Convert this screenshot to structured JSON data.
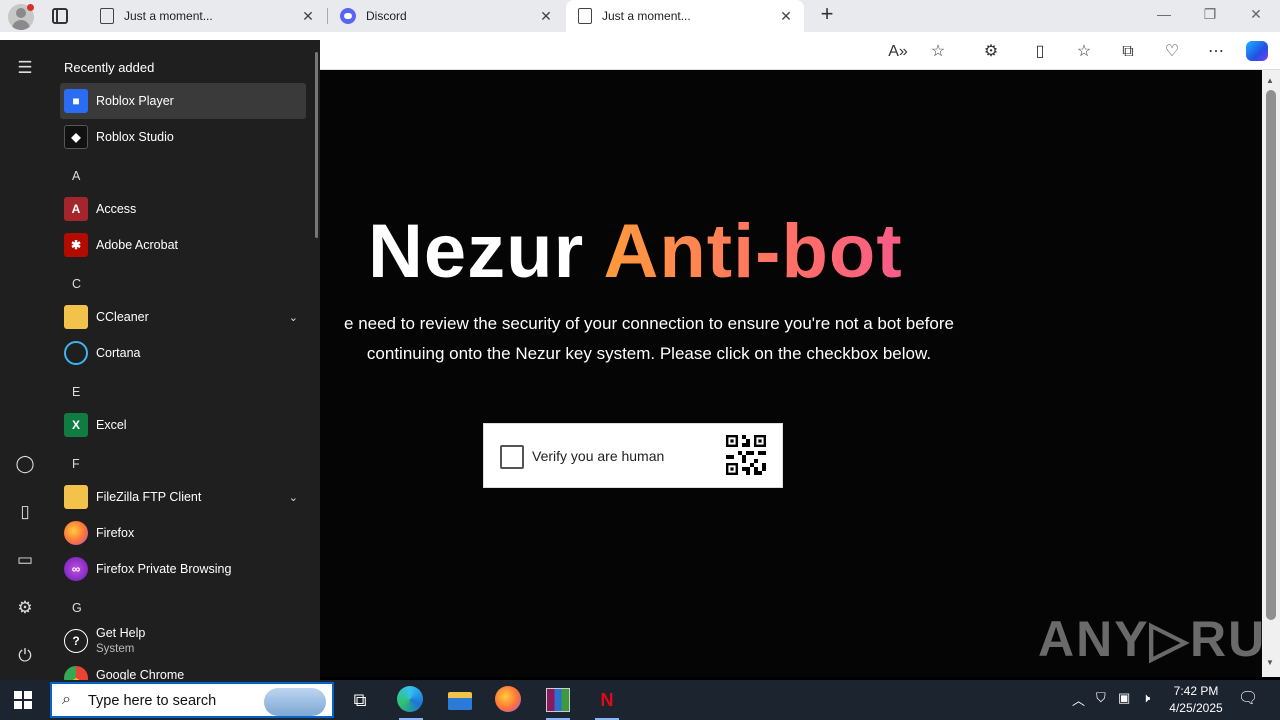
{
  "browser": {
    "tabs": [
      {
        "title": "Just a moment...",
        "close": "✕"
      },
      {
        "title": "Discord",
        "close": "✕"
      },
      {
        "title": "Just a moment...",
        "close": "✕"
      }
    ],
    "new_tab": "+",
    "window_controls": {
      "minimize": "—",
      "restore": "❐",
      "close": "✕"
    },
    "toolbar_icons": [
      "read-aloud-icon",
      "favorite-star-icon",
      "extensions-icon",
      "split-screen-icon",
      "favorites-icon",
      "collections-icon",
      "performance-icon",
      "more-icon",
      "copilot-icon"
    ]
  },
  "page": {
    "heading_white": "Nezur",
    "heading_gradient": "Anti-bot",
    "description_line1": "e need to review the security of your connection to ensure you're not a bot before",
    "description_line2": "continuing onto the Nezur key system. Please click on the checkbox below.",
    "verify_label": "Verify you are human",
    "watermark": "ANY▷RUN"
  },
  "start_menu": {
    "header": "Recently added",
    "items": [
      {
        "label": "Roblox Player",
        "icon": "roblox-player-icon",
        "color": "#2b6cf5"
      },
      {
        "label": "Roblox Studio",
        "icon": "roblox-studio-icon",
        "color": "#111111"
      },
      {
        "letter": "A"
      },
      {
        "label": "Access",
        "icon": "access-icon",
        "color": "#a4262c",
        "glyph": "A"
      },
      {
        "label": "Adobe Acrobat",
        "icon": "acrobat-icon",
        "color": "#b30b00",
        "glyph": "✱"
      },
      {
        "letter": "C"
      },
      {
        "label": "CCleaner",
        "icon": "folder-icon",
        "color": "#f2c24b",
        "expand": "⌄"
      },
      {
        "label": "Cortana",
        "icon": "cortana-icon",
        "color": "#1f1f1f"
      },
      {
        "letter": "E"
      },
      {
        "label": "Excel",
        "icon": "excel-icon",
        "color": "#107c41",
        "glyph": "X"
      },
      {
        "letter": "F"
      },
      {
        "label": "FileZilla FTP Client",
        "icon": "folder-icon",
        "color": "#f2c24b",
        "expand": "⌄"
      },
      {
        "label": "Firefox",
        "icon": "firefox-icon",
        "color": "#ff7139"
      },
      {
        "label": "Firefox Private Browsing",
        "icon": "firefox-private-icon",
        "color": "#8a2be2"
      },
      {
        "letter": "G"
      },
      {
        "label": "Get Help",
        "sub": "System",
        "icon": "get-help-icon",
        "color": "#1f1f1f",
        "glyph": "?"
      },
      {
        "label": "Google Chrome",
        "icon": "chrome-icon",
        "color": "#4285f4"
      }
    ]
  },
  "taskbar": {
    "search_placeholder": "Type here to search",
    "time": "7:42 PM",
    "date": "4/25/2025"
  }
}
